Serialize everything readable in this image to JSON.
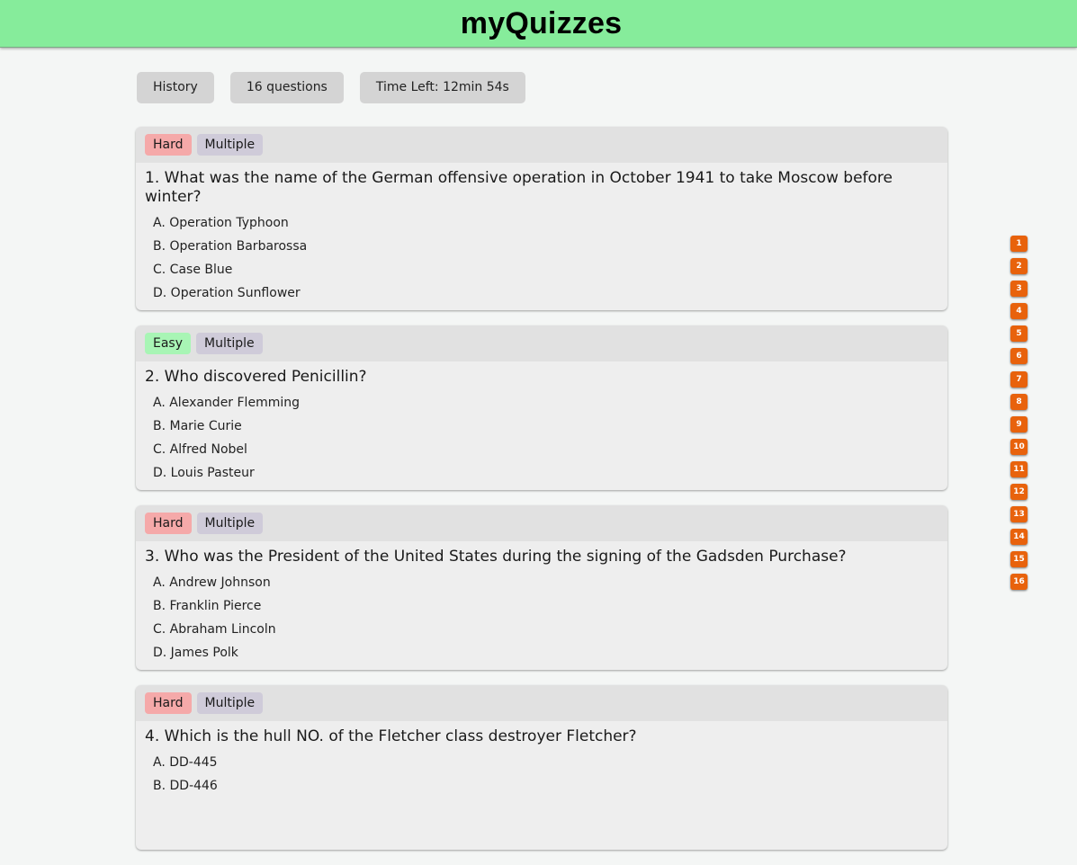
{
  "app": {
    "title": "myQuizzes"
  },
  "info": {
    "category": "History",
    "question_count": "16 questions",
    "time_left": "Time Left: 12min 54s"
  },
  "questions": [
    {
      "difficulty": "Hard",
      "type": "Multiple",
      "text": "1. What was the name of the German offensive operation in October 1941 to take Moscow before winter?",
      "options": [
        "A. Operation Typhoon",
        "B. Operation Barbarossa",
        "C. Case Blue",
        "D. Operation Sunflower"
      ]
    },
    {
      "difficulty": "Easy",
      "type": "Multiple",
      "text": "2. Who discovered Penicillin?",
      "options": [
        "A. Alexander Flemming",
        "B. Marie Curie",
        "C. Alfred Nobel",
        "D. Louis Pasteur"
      ]
    },
    {
      "difficulty": "Hard",
      "type": "Multiple",
      "text": "3. Who was the President of the United States during the signing of the Gadsden Purchase?",
      "options": [
        "A. Andrew Johnson",
        "B. Franklin Pierce",
        "C. Abraham Lincoln",
        "D. James Polk"
      ]
    },
    {
      "difficulty": "Hard",
      "type": "Multiple",
      "text": "4. Which is the hull NO. of the Fletcher class destroyer Fletcher?",
      "options": [
        "A. DD-445",
        "B. DD-446",
        "",
        ""
      ]
    }
  ],
  "navigator": [
    "1",
    "2",
    "3",
    "4",
    "5",
    "6",
    "7",
    "8",
    "9",
    "10",
    "11",
    "12",
    "13",
    "14",
    "15",
    "16"
  ],
  "colors": {
    "header_bg": "#86ec9b",
    "nav_button": "#e8620c",
    "tag_hard": "#f5a9a9",
    "tag_easy": "#a8f5b5",
    "tag_type": "#cfcbd9"
  }
}
